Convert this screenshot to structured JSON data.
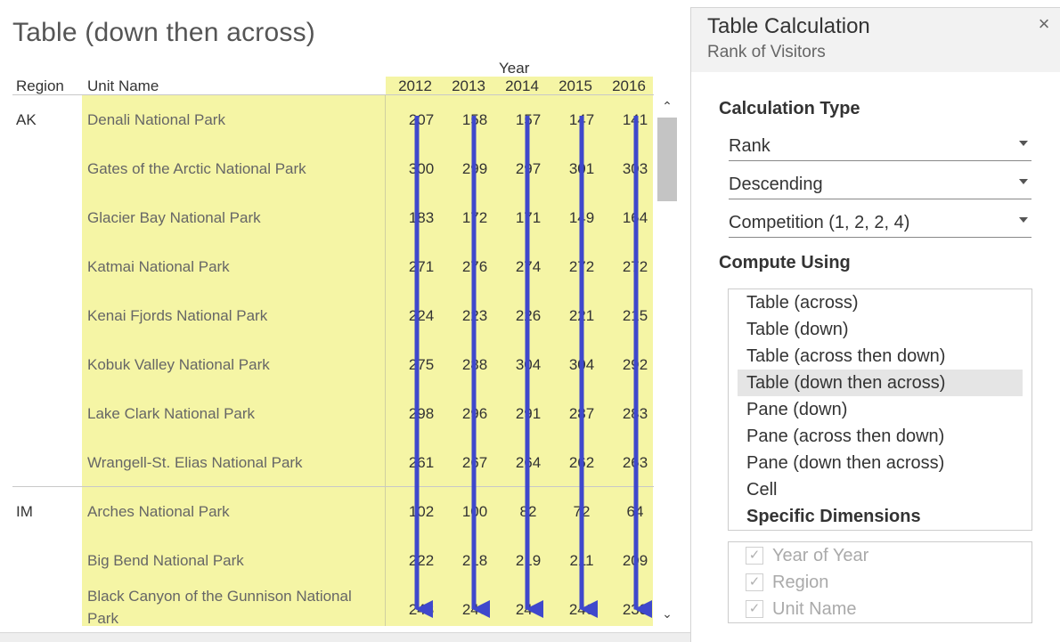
{
  "view": {
    "title": "Table (down then across)",
    "year_header": "Year",
    "region_header": "Region",
    "unit_header": "Unit Name",
    "years": [
      "2012",
      "2013",
      "2014",
      "2015",
      "2016"
    ],
    "regions": [
      {
        "name": "AK",
        "rows": [
          {
            "unit": "Denali National Park",
            "values": [
              "207",
              "158",
              "157",
              "147",
              "141"
            ]
          },
          {
            "unit": "Gates of the Arctic National Park",
            "values": [
              "300",
              "299",
              "297",
              "301",
              "303"
            ]
          },
          {
            "unit": "Glacier Bay National Park",
            "values": [
              "183",
              "172",
              "171",
              "149",
              "164"
            ]
          },
          {
            "unit": "Katmai National Park",
            "values": [
              "271",
              "276",
              "274",
              "272",
              "272"
            ]
          },
          {
            "unit": "Kenai Fjords National Park",
            "values": [
              "224",
              "223",
              "226",
              "221",
              "215"
            ]
          },
          {
            "unit": "Kobuk Valley National Park",
            "values": [
              "275",
              "288",
              "304",
              "304",
              "292"
            ]
          },
          {
            "unit": "Lake Clark National Park",
            "values": [
              "298",
              "296",
              "291",
              "287",
              "283"
            ]
          },
          {
            "unit": "Wrangell-St. Elias National Park",
            "values": [
              "261",
              "267",
              "264",
              "262",
              "263"
            ]
          }
        ]
      },
      {
        "name": "IM",
        "rows": [
          {
            "unit": "Arches National Park",
            "values": [
              "102",
              "100",
              "82",
              "72",
              "64"
            ]
          },
          {
            "unit": "Big Bend National Park",
            "values": [
              "222",
              "218",
              "219",
              "211",
              "209"
            ]
          },
          {
            "unit": "Black Canyon of the Gunnison National Park",
            "values": [
              "243",
              "246",
              "244",
              "240",
              "233"
            ]
          }
        ]
      }
    ],
    "highlight_color": "#f5f5a5",
    "arrow_color": "#3f48cc"
  },
  "panel": {
    "title": "Table Calculation",
    "subtitle": "Rank of Visitors",
    "close_glyph": "×",
    "calc_type_label": "Calculation Type",
    "calc_type_value": "Rank",
    "order_value": "Descending",
    "rank_method_value": "Competition (1, 2, 2, 4)",
    "compute_using_label": "Compute Using",
    "compute_using_options": [
      "Table (across)",
      "Table (down)",
      "Table (across then down)",
      "Table (down then across)",
      "Pane (down)",
      "Pane (across then down)",
      "Pane (down then across)",
      "Cell",
      "Specific Dimensions"
    ],
    "compute_using_selected": "Table (down then across)",
    "specific_dimensions": [
      {
        "label": "Year of Year",
        "checked": true
      },
      {
        "label": "Region",
        "checked": true
      },
      {
        "label": "Unit Name",
        "checked": true
      }
    ]
  }
}
